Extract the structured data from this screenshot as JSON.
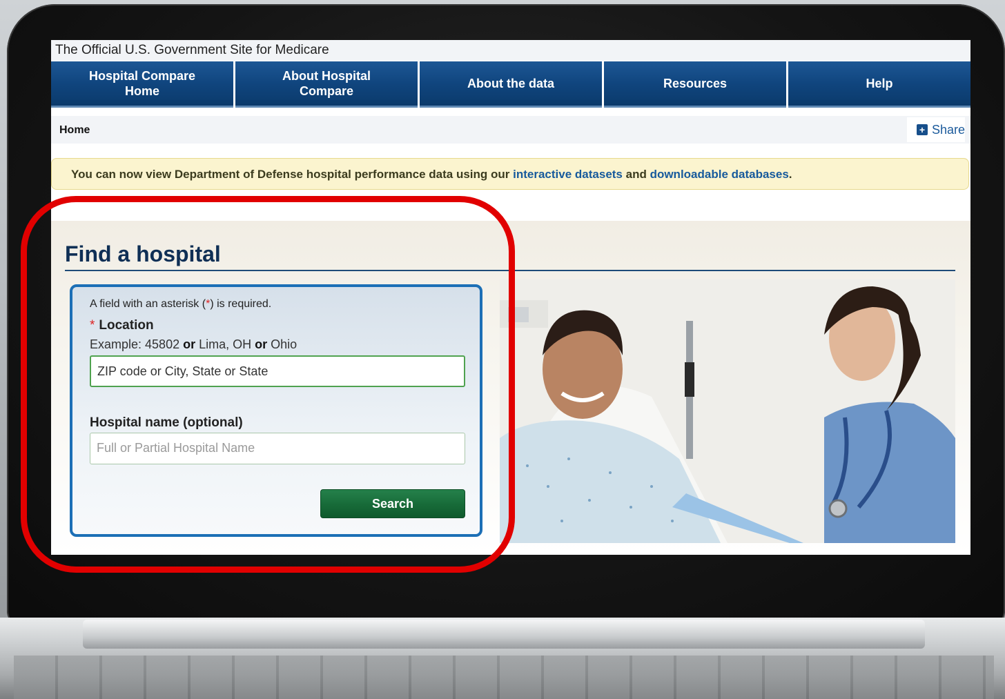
{
  "site_banner": "The Official U.S. Government Site for Medicare",
  "nav": [
    {
      "line1": "Hospital Compare",
      "line2": "Home"
    },
    {
      "line1": "About Hospital",
      "line2": "Compare"
    },
    {
      "line1": "About the data",
      "line2": ""
    },
    {
      "line1": "Resources",
      "line2": ""
    },
    {
      "line1": "Help",
      "line2": ""
    }
  ],
  "breadcrumb": "Home",
  "share_label": "Share",
  "notice": {
    "prefix": "You can now view Department of Defense hospital performance data using our ",
    "link1": "interactive datasets",
    "middle": " and ",
    "link2": "downloadable databases",
    "suffix": "."
  },
  "find": {
    "title": "Find a hospital",
    "required_note": {
      "prefix": "A field with an asterisk (",
      "asterisk": "*",
      "suffix": ") is required."
    },
    "location_label": "Location",
    "asterisk": "*",
    "example": {
      "prefix": "Example: 45802 ",
      "or1": "or",
      "mid": " Lima, OH ",
      "or2": "or",
      "suffix": " Ohio"
    },
    "location_placeholder": "ZIP code or City, State or State",
    "hospital_label": "Hospital name (optional)",
    "hospital_placeholder": "Full or Partial Hospital Name",
    "search_label": "Search"
  },
  "colors": {
    "nav_blue": "#10457e",
    "highlight_red": "#e10000",
    "search_green": "#176a38",
    "form_border": "#1c6fb6"
  }
}
